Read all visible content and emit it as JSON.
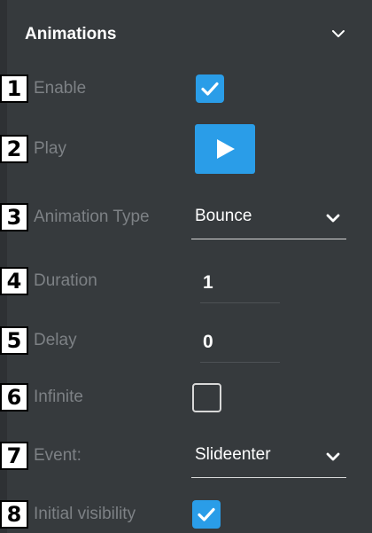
{
  "header": {
    "title": "Animations",
    "toggle_icon": "chevron-down-icon"
  },
  "rows": {
    "enable": {
      "badge": "1",
      "label": "Enable",
      "checked": true
    },
    "play": {
      "badge": "2",
      "label": "Play",
      "icon": "play-icon"
    },
    "animation_type": {
      "badge": "3",
      "label": "Animation Type",
      "value": "Bounce"
    },
    "duration": {
      "badge": "4",
      "label": "Duration",
      "value": "1"
    },
    "delay": {
      "badge": "5",
      "label": "Delay",
      "value": "0"
    },
    "infinite": {
      "badge": "6",
      "label": "Infinite",
      "checked": false
    },
    "event": {
      "badge": "7",
      "label": "Event:",
      "value": "Slideenter"
    },
    "initial_visibility": {
      "badge": "8",
      "label": "Initial visibility",
      "checked": true
    }
  },
  "colors": {
    "background": "#363a3d",
    "accent": "#2a9de8",
    "label": "#7d8185",
    "value": "#ffffff"
  }
}
